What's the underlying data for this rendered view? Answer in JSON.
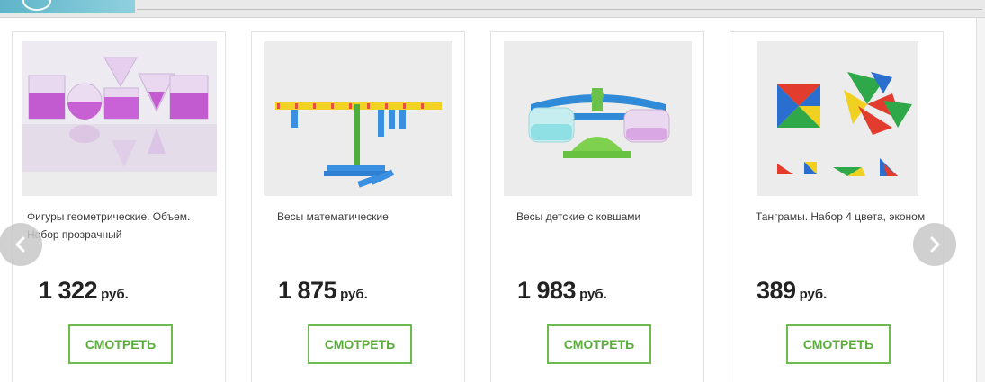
{
  "carousel": {
    "products": [
      {
        "name": "Фигуры геометрические. Объем. Набор прозрачный",
        "price": "1 322",
        "currency": "руб.",
        "button": "СМОТРЕТЬ",
        "image_icon": "geometric-shapes-image"
      },
      {
        "name": "Весы математические",
        "price": "1 875",
        "currency": "руб.",
        "button": "СМОТРЕТЬ",
        "image_icon": "math-balance-image"
      },
      {
        "name": "Весы детские с ковшами",
        "price": "1 983",
        "currency": "руб.",
        "button": "СМОТРЕТЬ",
        "image_icon": "kids-scale-image"
      },
      {
        "name": "Танграмы. Набор 4 цвета, эконом",
        "price": "389",
        "currency": "руб.",
        "button": "СМОТРЕТЬ",
        "image_icon": "tangram-image"
      }
    ],
    "prev_icon": "chevron-left-icon",
    "next_icon": "chevron-right-icon"
  },
  "colors": {
    "accent": "#5aad3c",
    "button_border": "#6dbb4d",
    "arrow_bg": "#c8c8c8"
  }
}
